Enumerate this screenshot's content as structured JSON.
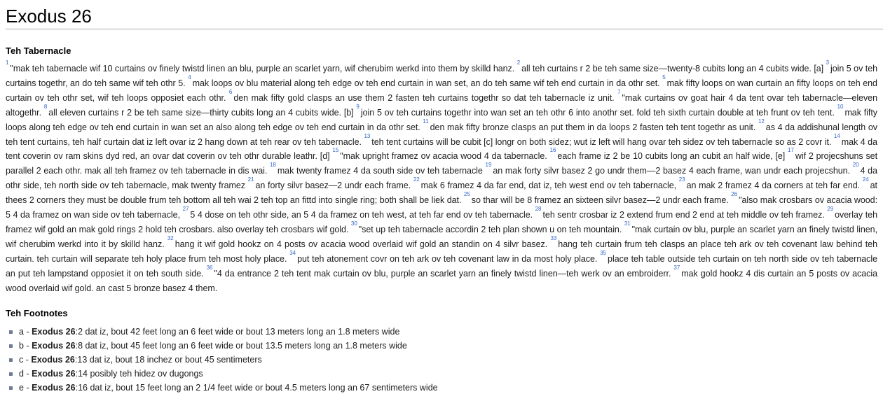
{
  "page_title": "Exodus 26",
  "section_title": "Teh Tabernacle",
  "footnotes_title": "Teh Footnotes",
  "verses": [
    {
      "n": "1",
      "t": "\"mak teh tabernacle wif 10 curtains ov finely twistd linen an blu, purple an scarlet yarn, wif cherubim werkd into them by skilld hanz. "
    },
    {
      "n": "2",
      "t": "all teh curtains r 2 be teh same size—twenty-8 cubits long an 4 cubits wide. ",
      "fn": "[a]"
    },
    {
      "n": "3",
      "t": "join 5 ov teh curtains togethr, an do teh same wif teh othr 5. "
    },
    {
      "n": "4",
      "t": "mak loops ov blu material along teh edge ov teh end curtain in wan set, an do teh same wif teh end curtain in da othr set. "
    },
    {
      "n": "5",
      "t": "mak fifty loops on wan curtain an fifty loops on teh end curtain ov teh othr set, wif teh loops opposiet each othr. "
    },
    {
      "n": "6",
      "t": "den mak fifty gold clasps an use them 2 fasten teh curtains togethr so dat teh tabernacle iz unit. "
    },
    {
      "n": "7",
      "t": "\"mak curtains ov goat hair 4 da tent ovar teh tabernacle—eleven altogethr. "
    },
    {
      "n": "8",
      "t": "all eleven curtains r 2 be teh same size—thirty cubits long an 4 cubits wide. ",
      "fn": "[b]"
    },
    {
      "n": "9",
      "t": "join 5 ov teh curtains togethr into wan set an teh othr 6 into anothr set. fold teh sixth curtain double at teh frunt ov teh tent. "
    },
    {
      "n": "10",
      "t": "mak fifty loops along teh edge ov teh end curtain in wan set an also along teh edge ov teh end curtain in da othr set. "
    },
    {
      "n": "11",
      "t": "den mak fifty bronze clasps an put them in da loops 2 fasten teh tent togethr as unit. "
    },
    {
      "n": "12",
      "t": "as 4 da addishunal length ov teh tent curtains, teh half curtain dat iz left ovar iz 2 hang down at teh rear ov teh tabernacle. "
    },
    {
      "n": "13",
      "t": "teh tent curtains will be cubit ",
      "fn": "[c]",
      "t2": " longr on both sidez; wut iz left will hang ovar teh sidez ov teh tabernacle so as 2 covr it. "
    },
    {
      "n": "14",
      "t": "mak 4 da tent coverin ov ram skins dyd red, an ovar dat coverin ov teh othr durable leathr. ",
      "fn": "[d]"
    },
    {
      "n": "15",
      "t": "\"mak upright framez ov acacia wood 4 da tabernacle. "
    },
    {
      "n": "16",
      "t": "each frame iz 2 be 10 cubits long an cubit an half wide, ",
      "fn": "[e]"
    },
    {
      "n": "17",
      "t": "wif 2 projecshuns set parallel 2 each othr. mak all teh framez ov teh tabernacle in dis wai. "
    },
    {
      "n": "18",
      "t": "mak twenty framez 4 da south side ov teh tabernacle "
    },
    {
      "n": "19",
      "t": "an mak forty silvr basez 2 go undr them—2 basez 4 each frame, wan undr each projecshun. "
    },
    {
      "n": "20",
      "t": "4 da othr side, teh north side ov teh tabernacle, mak twenty framez "
    },
    {
      "n": "21",
      "t": "an forty silvr basez—2 undr each frame. "
    },
    {
      "n": "22",
      "t": "mak 6 framez 4 da far end, dat iz, teh west end ov teh tabernacle, "
    },
    {
      "n": "23",
      "t": "an mak 2 framez 4 da corners at teh far end. "
    },
    {
      "n": "24",
      "t": "at thees 2 corners they must be double frum teh bottom all teh wai 2 teh top an fittd into single ring; both shall be liek dat. "
    },
    {
      "n": "25",
      "t": "so thar will be 8 framez an sixteen silvr basez—2 undr each frame. "
    },
    {
      "n": "26",
      "t": "\"also mak crosbars ov acacia wood: 5 4 da framez on wan side ov teh tabernacle, "
    },
    {
      "n": "27",
      "t": "5 4 dose on teh othr side, an 5 4 da framez on teh west, at teh far end ov teh tabernacle. "
    },
    {
      "n": "28",
      "t": "teh sentr crosbar iz 2 extend frum end 2 end at teh middle ov teh framez. "
    },
    {
      "n": "29",
      "t": "overlay teh framez wif gold an mak gold rings 2 hold teh crosbars. also overlay teh crosbars wif gold. "
    },
    {
      "n": "30",
      "t": "\"set up teh tabernacle accordin 2 teh plan shown u on teh mountain. "
    },
    {
      "n": "31",
      "t": "\"mak curtain ov blu, purple an scarlet yarn an finely twistd linen, wif cherubim werkd into it by skilld hanz. "
    },
    {
      "n": "32",
      "t": "hang it wif gold hookz on 4 posts ov acacia wood overlaid wif gold an standin on 4 silvr basez. "
    },
    {
      "n": "33",
      "t": "hang teh curtain frum teh clasps an place teh ark ov teh covenant law behind teh curtain. teh curtain will separate teh holy place frum teh most holy place. "
    },
    {
      "n": "34",
      "t": "put teh atonement covr on teh ark ov teh covenant law in da most holy place. "
    },
    {
      "n": "35",
      "t": "place teh table outside teh curtain on teh north side ov teh tabernacle an put teh lampstand opposiet it on teh south side. "
    },
    {
      "n": "36",
      "t": "\"4 da entrance 2 teh tent mak curtain ov blu, purple an scarlet yarn an finely twistd linen—teh werk ov an embroiderr. "
    },
    {
      "n": "37",
      "t": "mak gold hookz 4 dis curtain an 5 posts ov acacia wood overlaid wif gold. an cast 5 bronze basez 4 them."
    }
  ],
  "footnotes": [
    {
      "letter": "a",
      "ref": "Exodus 26",
      "verse": ":2",
      "text": " dat iz, bout 42 feet long an 6 feet wide or bout 13 meters long an 1.8 meters wide"
    },
    {
      "letter": "b",
      "ref": "Exodus 26",
      "verse": ":8",
      "text": " dat iz, bout 45 feet long an 6 feet wide or bout 13.5 meters long an 1.8 meters wide"
    },
    {
      "letter": "c",
      "ref": "Exodus 26",
      "verse": ":13",
      "text": " dat iz, bout 18 inchez or bout 45 sentimeters"
    },
    {
      "letter": "d",
      "ref": "Exodus 26",
      "verse": ":14",
      "text": " posibly teh hidez ov dugongs"
    },
    {
      "letter": "e",
      "ref": "Exodus 26",
      "verse": ":16",
      "text": " dat iz, bout 15 feet long an 2 1/4 feet wide or bout 4.5 meters long an 67 sentimeters wide"
    }
  ]
}
